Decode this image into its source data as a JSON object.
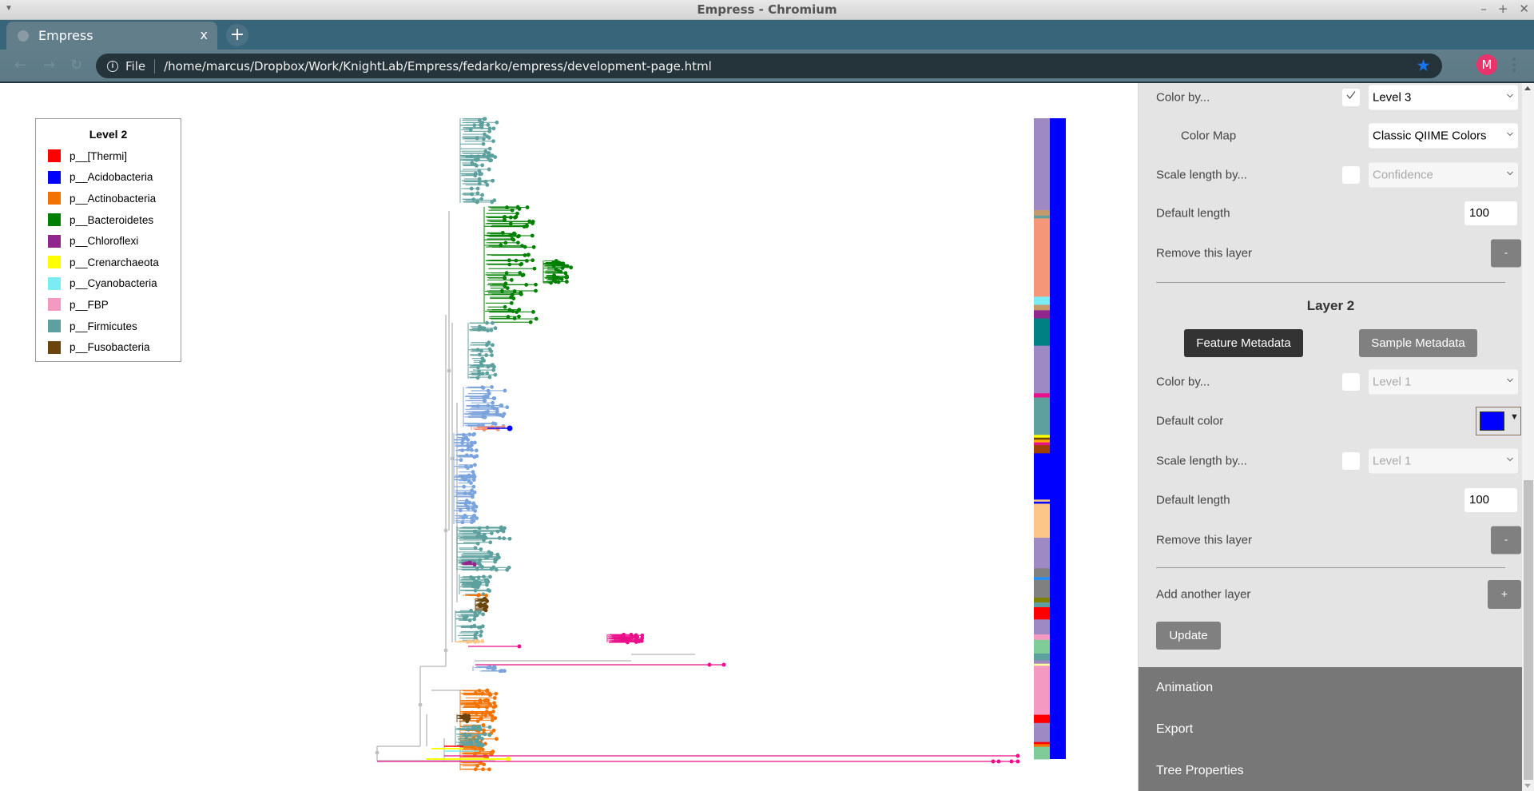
{
  "window": {
    "title": "Empress - Chromium",
    "controls": [
      "–",
      "+",
      "✕"
    ]
  },
  "browser": {
    "tab_title": "Empress",
    "tab_close": "x",
    "new_tab": "+",
    "scheme_label": "File",
    "url": "/home/marcus/Dropbox/Work/KnightLab/Empress/fedarko/empress/development-page.html",
    "nav": {
      "back": "←",
      "forward": "→",
      "reload": "↻"
    },
    "bookmark_icon": "★",
    "avatar_initial": "M",
    "info_icon": "i"
  },
  "legend": {
    "title": "Level 2",
    "items": [
      {
        "label": "p__[Thermi]",
        "color": "#ff0000"
      },
      {
        "label": "p__Acidobacteria",
        "color": "#0000ff"
      },
      {
        "label": "p__Actinobacteria",
        "color": "#f27304"
      },
      {
        "label": "p__Bacteroidetes",
        "color": "#008000"
      },
      {
        "label": "p__Chloroflexi",
        "color": "#91278d"
      },
      {
        "label": "p__Crenarchaeota",
        "color": "#ffff00"
      },
      {
        "label": "p__Cyanobacteria",
        "color": "#7cecf4"
      },
      {
        "label": "p__FBP",
        "color": "#f49ac2"
      },
      {
        "label": "p__Firmicutes",
        "color": "#5da09e"
      },
      {
        "label": "p__Fusobacteria",
        "color": "#6b440b"
      },
      {
        "label": "",
        "color": "#808080"
      }
    ]
  },
  "tree_colors": {
    "firmicutes": "#5da09e",
    "bacteroidetes": "#008000",
    "proteobacteria": "#7ba3dc",
    "actinobacteria": "#f27304",
    "fusobacteria": "#6b440b",
    "chloroflexi": "#91278d",
    "magenta": "#ea0f8a",
    "acidobacteria": "#0000ff",
    "crenarchaeota": "#ffff00",
    "cyanobacteria": "#7cecf4",
    "thermi": "#ff0000",
    "salmon": "#f58a6e",
    "peach": "#fcc688",
    "unassigned": "#c0c0c0"
  },
  "barplot": {
    "layer1_segments": [
      {
        "frac": 0.135,
        "color": "#9e89c4"
      },
      {
        "frac": 0.008,
        "color": "#c49a6c"
      },
      {
        "frac": 0.004,
        "color": "#5da09e"
      },
      {
        "frac": 0.115,
        "color": "#f59679"
      },
      {
        "frac": 0.012,
        "color": "#7cecf4"
      },
      {
        "frac": 0.008,
        "color": "#c49a6c"
      },
      {
        "frac": 0.012,
        "color": "#91278d"
      },
      {
        "frac": 0.04,
        "color": "#008080"
      },
      {
        "frac": 0.07,
        "color": "#9e89c4"
      },
      {
        "frac": 0.006,
        "color": "#ea0f8a"
      },
      {
        "frac": 0.055,
        "color": "#5da09e"
      },
      {
        "frac": 0.004,
        "color": "#ffff00"
      },
      {
        "frac": 0.003,
        "color": "#6b440b"
      },
      {
        "frac": 0.004,
        "color": "#ffaa00"
      },
      {
        "frac": 0.004,
        "color": "#ea0f8a"
      },
      {
        "frac": 0.012,
        "color": "#a04000"
      },
      {
        "frac": 0.068,
        "color": "#0000ff"
      },
      {
        "frac": 0.003,
        "color": "#fcc688"
      },
      {
        "frac": 0.003,
        "color": "#0000ff"
      },
      {
        "frac": 0.05,
        "color": "#fcc688"
      },
      {
        "frac": 0.045,
        "color": "#9e89c4"
      },
      {
        "frac": 0.013,
        "color": "#808080"
      },
      {
        "frac": 0.004,
        "color": "#1e90ff"
      },
      {
        "frac": 0.026,
        "color": "#808080"
      },
      {
        "frac": 0.007,
        "color": "#808000"
      },
      {
        "frac": 0.007,
        "color": "#5da09e"
      },
      {
        "frac": 0.018,
        "color": "#ff0000"
      },
      {
        "frac": 0.022,
        "color": "#9e89c4"
      },
      {
        "frac": 0.008,
        "color": "#f49ac2"
      },
      {
        "frac": 0.02,
        "color": "#80cc99"
      },
      {
        "frac": 0.01,
        "color": "#5da09e"
      },
      {
        "frac": 0.005,
        "color": "#9e89c4"
      },
      {
        "frac": 0.003,
        "color": "#ffff99"
      },
      {
        "frac": 0.072,
        "color": "#f49ac2"
      },
      {
        "frac": 0.012,
        "color": "#ff0000"
      },
      {
        "frac": 0.028,
        "color": "#9e89c4"
      },
      {
        "frac": 0.003,
        "color": "#ff0000"
      },
      {
        "frac": 0.004,
        "color": "#f27304"
      },
      {
        "frac": 0.018,
        "color": "#80cc99"
      }
    ],
    "layer2_color": "#0000ff"
  },
  "panel": {
    "layer1": {
      "color_by_label": "Color by...",
      "color_by_checked": true,
      "color_by_value": "Level 3",
      "color_map_label": "Color Map",
      "color_map_value": "Classic QIIME Colors",
      "scale_label": "Scale length by...",
      "scale_checked": false,
      "scale_value": "Confidence",
      "default_length_label": "Default length",
      "default_length_value": "100",
      "remove_label": "Remove this layer",
      "remove_button": "-"
    },
    "layer2": {
      "title": "Layer 2",
      "feature_metadata_button": "Feature Metadata",
      "sample_metadata_button": "Sample Metadata",
      "color_by_label": "Color by...",
      "color_by_checked": false,
      "color_by_value": "Level 1",
      "default_color_label": "Default color",
      "default_color_value": "#0000ff",
      "color_dropdown_arrow": "▼",
      "scale_label": "Scale length by...",
      "scale_checked": false,
      "scale_value": "Level 1",
      "default_length_label": "Default length",
      "default_length_value": "100",
      "remove_label": "Remove this layer",
      "remove_button": "-"
    },
    "add_layer_label": "Add another layer",
    "add_layer_button": "+",
    "update_button": "Update",
    "sections": [
      "Animation",
      "Export",
      "Tree Properties"
    ]
  }
}
